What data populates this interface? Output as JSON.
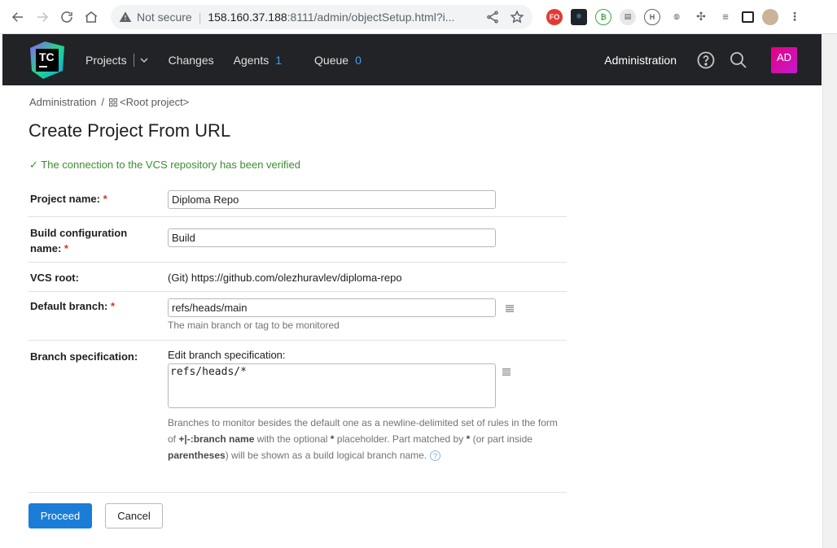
{
  "browser": {
    "not_secure": "Not secure",
    "url_host": "158.160.37.188",
    "url_rest": ":8111/admin/objectSetup.html?i..."
  },
  "header": {
    "logo_text": "TC",
    "nav": {
      "projects": "Projects",
      "changes": "Changes",
      "agents": "Agents",
      "agents_count": "1",
      "queue": "Queue",
      "queue_count": "0"
    },
    "administration": "Administration",
    "avatar_initials": "AD"
  },
  "breadcrumb": {
    "admin": "Administration",
    "separator": "/",
    "root": "<Root project>"
  },
  "page": {
    "title": "Create Project From URL",
    "success_message": "✓ The connection to the VCS repository has been verified"
  },
  "form": {
    "project_name": {
      "label": "Project name:",
      "required": "*",
      "value": "Diploma Repo"
    },
    "build_config": {
      "label_line1": "Build configuration",
      "label_line2": "name:",
      "required": "*",
      "value": "Build"
    },
    "vcs_root": {
      "label": "VCS root:",
      "value": "(Git) https://github.com/olezhuravlev/diploma-repo"
    },
    "default_branch": {
      "label": "Default branch:",
      "required": "*",
      "value": "refs/heads/main",
      "hint": "The main branch or tag to be monitored"
    },
    "branch_spec": {
      "label": "Branch specification:",
      "edit_label": "Edit branch specification:",
      "value": "refs/heads/*",
      "hint_1": "Branches to monitor besides the default one as a newline-delimited set of rules in the form of ",
      "hint_bold_1": "+|-:branch name",
      "hint_2": " with the optional ",
      "hint_bold_2": "*",
      "hint_3": " placeholder. Part matched by ",
      "hint_bold_3": "*",
      "hint_4": " (or part inside ",
      "hint_bold_4": "parentheses",
      "hint_5": ") will be shown as a build logical branch name.",
      "help": "?"
    }
  },
  "buttons": {
    "proceed": "Proceed",
    "cancel": "Cancel"
  },
  "colors": {
    "header_bg": "#222326",
    "accent": "#1a7dd8",
    "success": "#3a8d2f",
    "required": "#d9322b"
  }
}
